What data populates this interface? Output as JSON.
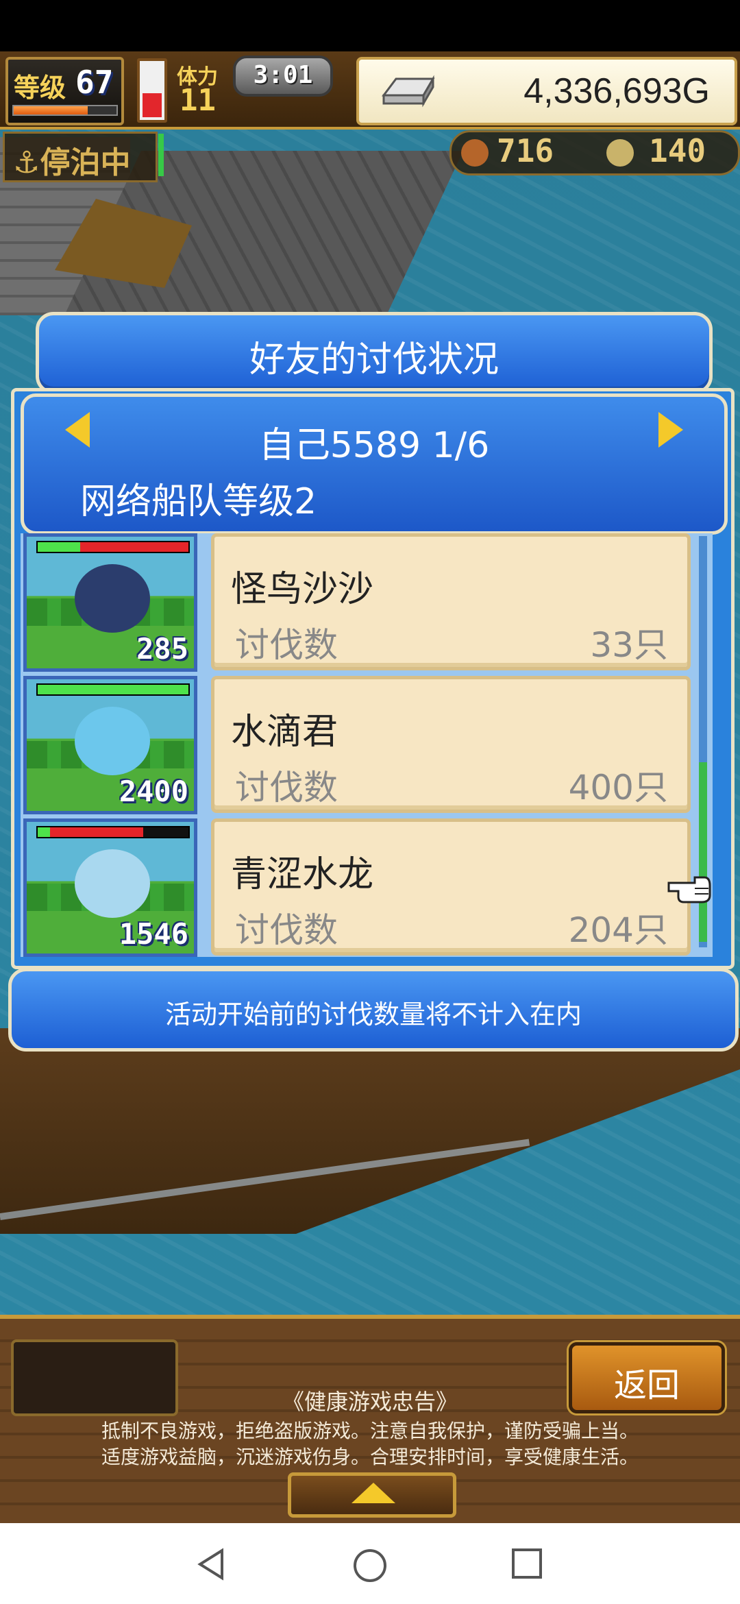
{
  "hud": {
    "level_label": "等级",
    "level_value": "67",
    "level_progress": 0.72,
    "stamina_label": "体力",
    "stamina_value": "11",
    "stamina_fill": 0.45,
    "timer": "3:01",
    "gold": "4,336,693G"
  },
  "world": {
    "anchor_status": "⚓停泊中",
    "resource_food": "716",
    "resource_coin": "140"
  },
  "dialog": {
    "title": "好友的讨伐状况",
    "page_info": "自己5589 1/6",
    "fleet_level": "网络船队等级2",
    "notice": "活动开始前的讨伐数量将不计入在内"
  },
  "monsters": [
    {
      "name": "怪鸟沙沙",
      "kill_label": "讨伐数",
      "kills": "33只",
      "portrait_number": "285",
      "hp_green": 0.28,
      "hp_red": 0.72,
      "color": "#2b3d6d"
    },
    {
      "name": "水滴君",
      "kill_label": "讨伐数",
      "kills": "400只",
      "portrait_number": "2400",
      "hp_green": 1.0,
      "hp_red": 0.0,
      "color": "#6cc7ec"
    },
    {
      "name": "青涩水龙",
      "kill_label": "讨伐数",
      "kills": "204只",
      "portrait_number": "1546",
      "hp_green": 0.08,
      "hp_red": 0.62,
      "color": "#a9d8ef"
    }
  ],
  "bottom": {
    "back_label": "返回",
    "advice_title": "《健康游戏忠告》",
    "advice_line1": "抵制不良游戏，拒绝盗版游戏。注意自我保护，谨防受骗上当。",
    "advice_line2": "适度游戏益脑，沉迷游戏伤身。合理安排时间，享受健康生活。"
  },
  "colors": {
    "dialog_blue": "#1d5fd4",
    "card_bg": "#f7e6c3",
    "accent_gold": "#f4c92a"
  }
}
